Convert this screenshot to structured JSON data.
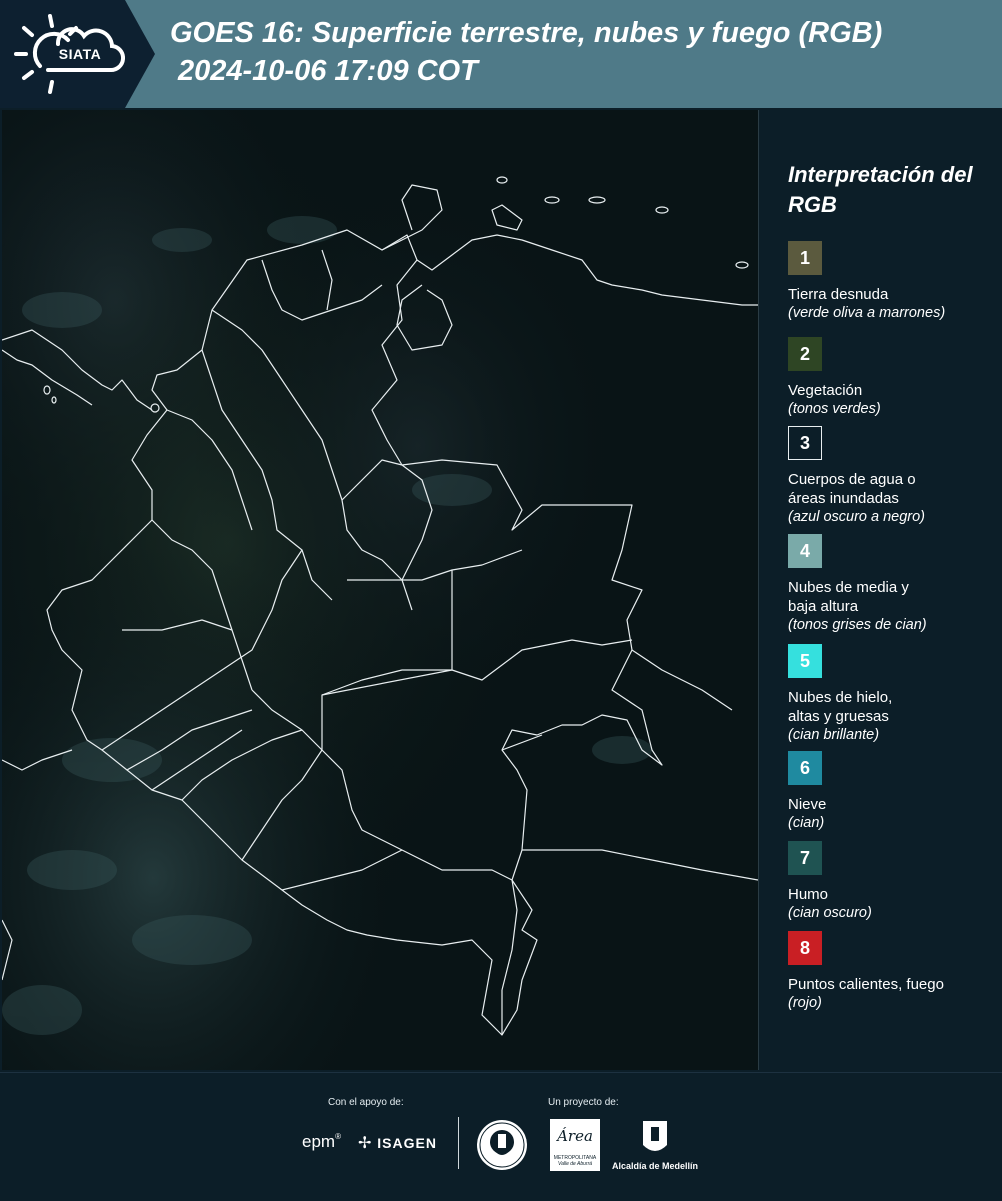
{
  "header": {
    "logo_text": "SIATA",
    "title_line1": "GOES 16: Superficie terrestre, nubes y fuego (RGB)",
    "title_line2": "2024-10-06 17:09 COT",
    "background_color": "#4f7a88"
  },
  "map": {
    "icon": "satellite-map-image"
  },
  "legend": {
    "title": "Interpretación del RGB",
    "items": [
      {
        "number": "1",
        "label": "Tierra desnuda",
        "desc": "(verde oliva a marrones)",
        "color": "#5b5a3e"
      },
      {
        "number": "2",
        "label": "Vegetación",
        "desc": "(tonos verdes)",
        "color": "#2e4524"
      },
      {
        "number": "3",
        "label": "Cuerpos de agua o áreas inundadas",
        "desc": "(azul oscuro a negro)",
        "color": "#0c1e28"
      },
      {
        "number": "4",
        "label": "Nubes de media y baja altura",
        "desc": "(tonos grises de cian)",
        "color": "#7aaaa9"
      },
      {
        "number": "5",
        "label": "Nubes de hielo, altas y gruesas",
        "desc": "(cian brillante)",
        "color": "#35e0de"
      },
      {
        "number": "6",
        "label": "Nieve",
        "desc": "(cian)",
        "color": "#1f8aa0"
      },
      {
        "number": "7",
        "label": "Humo",
        "desc": "(cian oscuro)",
        "color": "#1f5352"
      },
      {
        "number": "8",
        "label": "Puntos calientes, fuego",
        "desc": "(rojo)",
        "color": "#c91f24"
      }
    ]
  },
  "footer": {
    "support_label": "Con el apoyo de:",
    "project_label": "Un proyecto de:",
    "epm": "epm",
    "isagen": "ISAGEN",
    "area_line1": "Área",
    "area_line2": "METROPOLITANA",
    "area_line3": "Valle de Aburrá",
    "medellin": "Alcaldía de Medellín"
  }
}
